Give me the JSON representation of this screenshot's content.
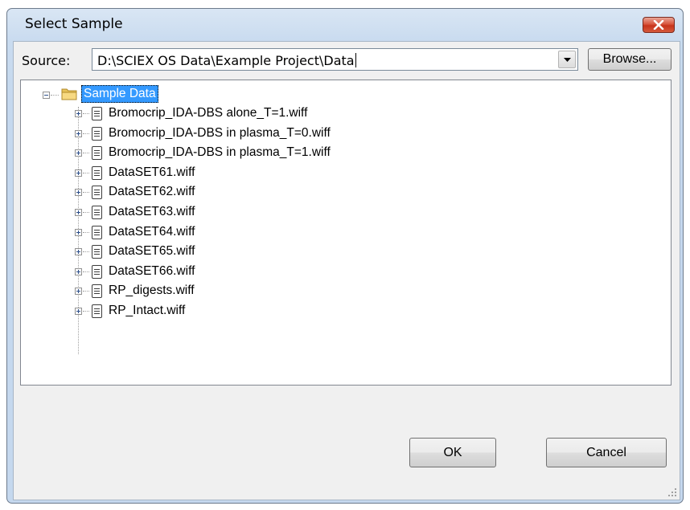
{
  "dialog": {
    "title": "Select Sample",
    "close_icon": "close-icon"
  },
  "source": {
    "label": "Source:",
    "value": "D:\\SCIEX OS Data\\Example Project\\Data",
    "browse_label": "Browse..."
  },
  "tree": {
    "root": {
      "label": "Sample Data",
      "icon": "folder-icon",
      "expanded": true,
      "selected": true
    },
    "items": [
      {
        "label": "Bromocrip_IDA-DBS alone_T=1.wiff"
      },
      {
        "label": "Bromocrip_IDA-DBS in plasma_T=0.wiff"
      },
      {
        "label": "Bromocrip_IDA-DBS in plasma_T=1.wiff"
      },
      {
        "label": "DataSET61.wiff"
      },
      {
        "label": "DataSET62.wiff"
      },
      {
        "label": "DataSET63.wiff"
      },
      {
        "label": "DataSET64.wiff"
      },
      {
        "label": "DataSET65.wiff"
      },
      {
        "label": "DataSET66.wiff"
      },
      {
        "label": "RP_digests.wiff"
      },
      {
        "label": "RP_Intact.wiff"
      }
    ]
  },
  "buttons": {
    "ok": "OK",
    "cancel": "Cancel"
  },
  "colors": {
    "selection": "#3399ff",
    "close_button": "#c7331b"
  }
}
